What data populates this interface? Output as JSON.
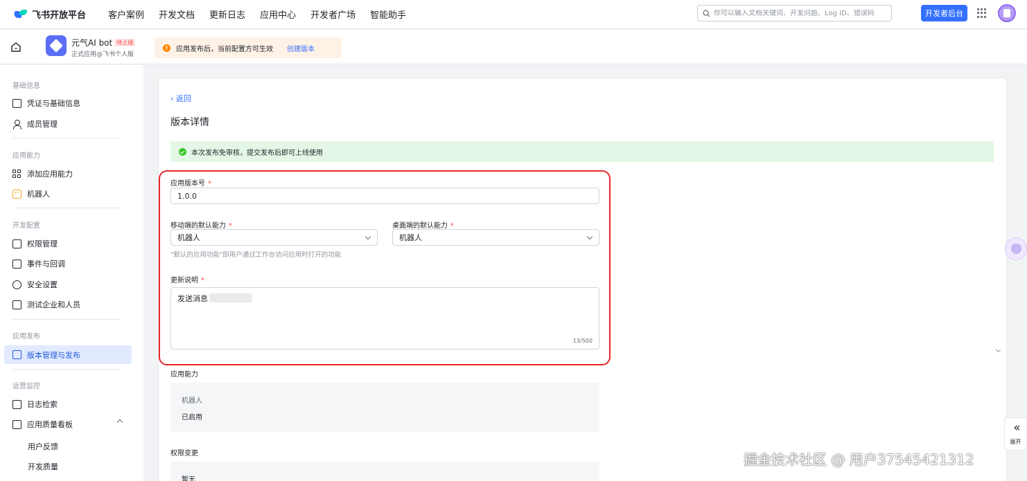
{
  "topnav": {
    "logo_text": "飞书开放平台",
    "items": [
      "客户案例",
      "开发文档",
      "更新日志",
      "应用中心",
      "开发者广场",
      "智能助手"
    ],
    "search_placeholder": "你可以输入文档关键词、开发问题、Log ID、错误码",
    "dev_button": "开发者后台"
  },
  "app": {
    "name": "元气AI bot",
    "badge": "待上线",
    "subtitle": "正式应用@飞书个人版"
  },
  "notice": {
    "text": "应用发布后，当前配置方可生效",
    "link": "创建版本"
  },
  "sidebar": {
    "sections": [
      "基础信息",
      "应用能力",
      "开发配置",
      "应用发布",
      "运营监控"
    ],
    "basic": [
      "凭证与基础信息",
      "成员管理"
    ],
    "capability": [
      "添加应用能力",
      "机器人"
    ],
    "devconfig": [
      "权限管理",
      "事件与回调",
      "安全设置",
      "测试企业和人员"
    ],
    "publish": [
      "版本管理与发布"
    ],
    "ops": [
      "日志检索",
      "应用质量看板"
    ],
    "ops_sub": [
      "用户反馈",
      "开发质量"
    ]
  },
  "main": {
    "back": "返回",
    "title": "版本详情",
    "success_text": "本次发布免审核，提交发布后即可上线使用",
    "version_label": "应用版本号",
    "version_value": "1.0.0",
    "mobile_label": "移动端的默认能力",
    "mobile_value": "机器人",
    "desktop_label": "桌面端的默认能力",
    "desktop_value": "机器人",
    "hint": "\"默认的应用功能\"即用户通过工作台访问应用时打开的功能",
    "notes_label": "更新说明",
    "notes_value": "发送消息",
    "notes_counter": "13/500",
    "ability_title": "应用能力",
    "ability_name": "机器人",
    "ability_status": "已启用",
    "perm_title": "权限变更",
    "perm_value": "暂无",
    "required_mark": "*"
  },
  "expand": {
    "chevrons": "«",
    "label": "展开"
  },
  "watermark": "掘金技术社区 @ 用户37545421312",
  "colors": {
    "primary": "#3370ff",
    "success_bg": "#e4f7e6",
    "highlight_border": "#e8262a",
    "notice_bg": "#fef1e6"
  }
}
